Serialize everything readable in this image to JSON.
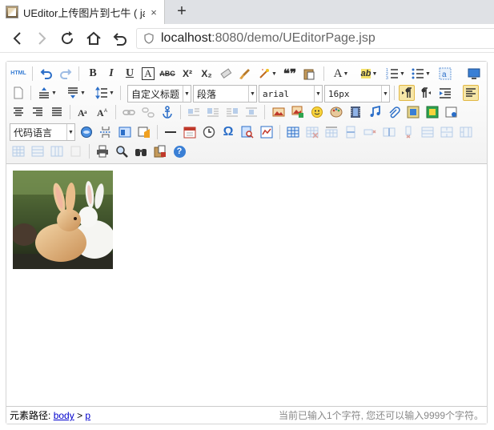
{
  "browser": {
    "tab_title": "UEditor上传图片到七牛 ( ja",
    "tab_close": "×",
    "new_tab": "+",
    "url_host": "localhost",
    "url_rest": ":8080/demo/UEditorPage.jsp"
  },
  "toolbar": {
    "source_label": "HTML",
    "bold": "B",
    "italic": "I",
    "underline": "U",
    "fontborder": "A",
    "strike": "ABC",
    "superscript": "X²",
    "subscript": "X₂",
    "blockquote": "❝❞",
    "fontcolor": "A",
    "backcolor": "ab",
    "customstyle": "自定义标题",
    "paragraph": "段落",
    "fontfamily": "arial",
    "fontsize": "16px",
    "codelanguage": "代码语言",
    "omega": "Ω",
    "help": "?"
  },
  "statusbar": {
    "path_label": "元素路径:",
    "path_body": "body",
    "path_sep": ">",
    "path_p": "p",
    "word_count": "当前已输入1个字符, 您还可以输入9999个字符。"
  },
  "colors": {
    "accent": "#3a7fd5",
    "active_bg": "#f7e7a8",
    "link": "#0000cc"
  }
}
